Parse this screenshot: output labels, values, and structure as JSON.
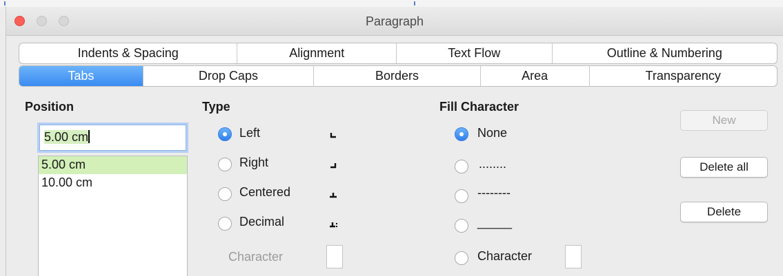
{
  "window": {
    "title": "Paragraph"
  },
  "tabs": {
    "row1": [
      "Indents & Spacing",
      "Alignment",
      "Text Flow",
      "Outline & Numbering"
    ],
    "row2": [
      "Tabs",
      "Drop Caps",
      "Borders",
      "Area",
      "Transparency"
    ],
    "active": "Tabs"
  },
  "position": {
    "heading": "Position",
    "input_value": "5.00 cm",
    "list": [
      "5.00 cm",
      "10.00 cm"
    ],
    "selected_index": 0
  },
  "type": {
    "heading": "Type",
    "options": [
      "Left",
      "Right",
      "Centered",
      "Decimal"
    ],
    "selected": "Left",
    "character_label": "Character"
  },
  "fill": {
    "heading": "Fill Character",
    "options": [
      "None",
      "........",
      "--------",
      "_____",
      "Character"
    ],
    "selected": "None"
  },
  "buttons": {
    "new": "New",
    "delete_all": "Delete all",
    "delete": "Delete"
  },
  "colors": {
    "accent": "#3a8bf2",
    "selection": "#d2f0b8",
    "close": "#fc5f57"
  }
}
